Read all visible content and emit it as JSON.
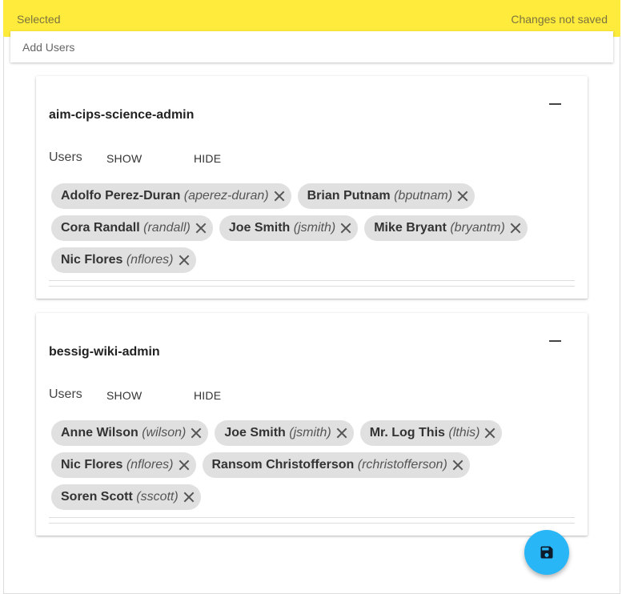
{
  "header": {
    "left_label": "Selected",
    "right_label": "Changes not saved"
  },
  "search": {
    "placeholder": "Add Users"
  },
  "groups": [
    {
      "title": "aim-cips-science-admin",
      "users_label": "Users",
      "show_label": "SHOW",
      "hide_label": "HIDE",
      "users": [
        {
          "name": "Adolfo Perez-Duran",
          "username": "(aperez-duran)"
        },
        {
          "name": "Brian Putnam",
          "username": "(bputnam)"
        },
        {
          "name": "Cora Randall",
          "username": "(randall)"
        },
        {
          "name": "Joe Smith",
          "username": "(jsmith)"
        },
        {
          "name": "Mike Bryant",
          "username": "(bryantm)"
        },
        {
          "name": "Nic Flores",
          "username": "(nflores)"
        }
      ]
    },
    {
      "title": "bessig-wiki-admin",
      "users_label": "Users",
      "show_label": "SHOW",
      "hide_label": "HIDE",
      "users": [
        {
          "name": "Anne Wilson",
          "username": "(wilson)"
        },
        {
          "name": "Joe Smith",
          "username": "(jsmith)"
        },
        {
          "name": "Mr. Log This",
          "username": "(lthis)"
        },
        {
          "name": "Nic Flores",
          "username": "(nflores)"
        },
        {
          "name": "Ransom Christofferson",
          "username": "(rchristofferson)"
        },
        {
          "name": "Soren Scott",
          "username": "(sscott)"
        }
      ]
    }
  ],
  "colors": {
    "header_bg": "#ffeb3b",
    "fab_bg": "#29b6f6",
    "chip_bg": "#e0e0e0"
  },
  "icons": {
    "fab": "save-icon",
    "chip_remove": "close-icon",
    "collapse": "minus-icon"
  }
}
